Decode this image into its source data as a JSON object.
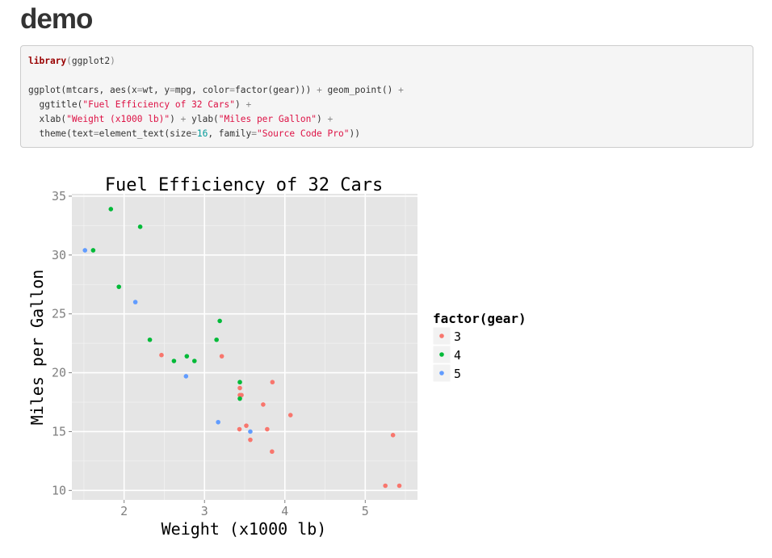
{
  "page": {
    "title": "demo"
  },
  "code": {
    "lines": [
      [
        [
          "kw",
          "library"
        ],
        [
          "op",
          "("
        ],
        [
          "tx",
          "ggplot2"
        ],
        [
          "op",
          ")"
        ]
      ],
      [],
      [
        [
          "tx",
          "ggplot(mtcars, aes(x"
        ],
        [
          "op",
          "="
        ],
        [
          "tx",
          "wt, y"
        ],
        [
          "op",
          "="
        ],
        [
          "tx",
          "mpg, color"
        ],
        [
          "op",
          "="
        ],
        [
          "tx",
          "factor(gear))) "
        ],
        [
          "op",
          "+"
        ],
        [
          "tx",
          " geom_point() "
        ],
        [
          "op",
          "+"
        ]
      ],
      [
        [
          "tx",
          "  ggtitle("
        ],
        [
          "str",
          "\"Fuel Efficiency of 32 Cars\""
        ],
        [
          "tx",
          ") "
        ],
        [
          "op",
          "+"
        ]
      ],
      [
        [
          "tx",
          "  xlab("
        ],
        [
          "str",
          "\"Weight (x1000 lb)\""
        ],
        [
          "tx",
          ") "
        ],
        [
          "op",
          "+"
        ],
        [
          "tx",
          " ylab("
        ],
        [
          "str",
          "\"Miles per Gallon\""
        ],
        [
          "tx",
          ") "
        ],
        [
          "op",
          "+"
        ]
      ],
      [
        [
          "tx",
          "  theme(text"
        ],
        [
          "op",
          "="
        ],
        [
          "tx",
          "element_text(size"
        ],
        [
          "op",
          "="
        ],
        [
          "num",
          "16"
        ],
        [
          "tx",
          ", family"
        ],
        [
          "op",
          "="
        ],
        [
          "str",
          "\"Source Code Pro\""
        ],
        [
          "tx",
          "))"
        ]
      ]
    ]
  },
  "chart_data": {
    "type": "scatter",
    "title": "Fuel Efficiency of 32 Cars",
    "xlabel": "Weight (x1000 lb)",
    "ylabel": "Miles per Gallon",
    "xlim": [
      1.35,
      5.65
    ],
    "ylim": [
      9.2,
      35.2
    ],
    "xticks": [
      2,
      3,
      4,
      5
    ],
    "yticks": [
      10,
      15,
      20,
      25,
      30,
      35
    ],
    "grid": true,
    "panel_background": "#e5e5e5",
    "legend": {
      "title": "factor(gear)",
      "position": "right"
    },
    "series": [
      {
        "name": "3",
        "color": "#f8766d",
        "x": [
          2.465,
          3.215,
          3.44,
          3.46,
          3.44,
          3.57,
          4.07,
          3.73,
          3.78,
          5.25,
          5.424,
          5.345,
          3.52,
          3.435,
          3.84,
          3.845
        ],
        "y": [
          21.5,
          21.4,
          18.7,
          18.1,
          18.1,
          14.3,
          16.4,
          17.3,
          15.2,
          10.4,
          10.4,
          14.7,
          15.5,
          15.2,
          13.3,
          19.2
        ]
      },
      {
        "name": "4",
        "color": "#00ba38",
        "x": [
          2.62,
          2.875,
          2.32,
          3.19,
          3.15,
          3.44,
          3.44,
          2.2,
          1.615,
          1.835,
          1.935,
          2.78
        ],
        "y": [
          21.0,
          21.0,
          22.8,
          24.4,
          22.8,
          19.2,
          17.8,
          32.4,
          30.4,
          33.9,
          27.3,
          21.4
        ]
      },
      {
        "name": "5",
        "color": "#619cff",
        "x": [
          2.14,
          1.513,
          3.17,
          2.77,
          3.57
        ],
        "y": [
          26.0,
          30.4,
          15.8,
          19.7,
          15.0
        ]
      }
    ]
  }
}
